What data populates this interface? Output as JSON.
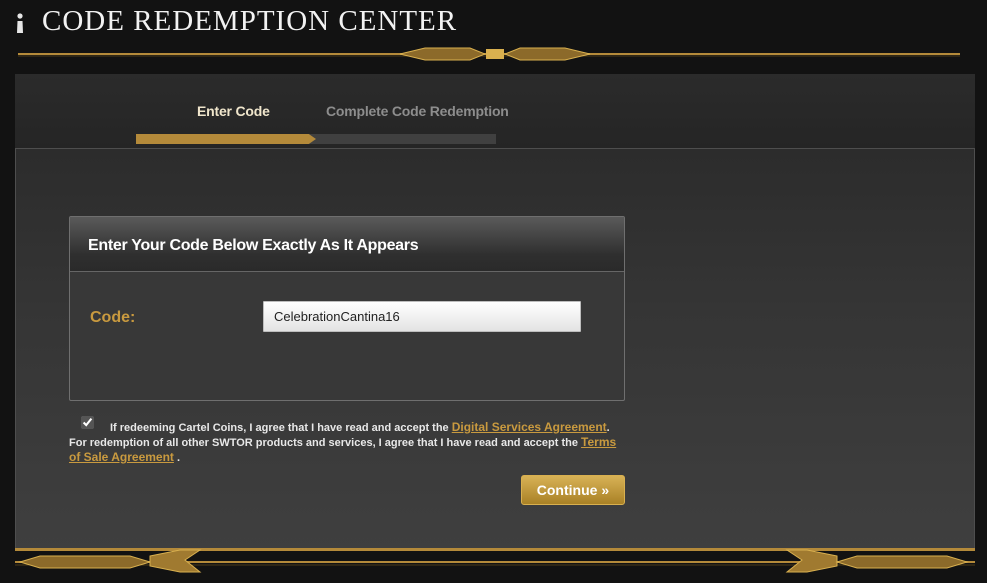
{
  "header": {
    "title": "CODE REDEMPTION CENTER",
    "icon": "person-icon"
  },
  "steps": {
    "items": [
      {
        "label": "Enter Code",
        "state": "active"
      },
      {
        "label": "Complete Code Redemption",
        "state": "inactive"
      }
    ],
    "progress": 0.5
  },
  "code_box": {
    "title": "Enter Your Code Below Exactly As It Appears",
    "code_label": "Code:",
    "code_value": "CelebrationCantina16"
  },
  "agreement": {
    "checked": true,
    "text_1": "If redeeming Cartel Coins, I agree that I have read and accept the ",
    "link_1": "Digital Services Agreement",
    "text_2": ". For redemption of all other SWTOR products and services, I agree that I have read and accept the ",
    "link_2": "Terms of Sale Agreement",
    "text_3": " ."
  },
  "continue_button": {
    "label": "Continue",
    "icon": "double-chevron-right-icon"
  },
  "colors": {
    "accent_gold": "#c99a3f",
    "progress_gold": "#b48a3a",
    "background": "#121212"
  }
}
